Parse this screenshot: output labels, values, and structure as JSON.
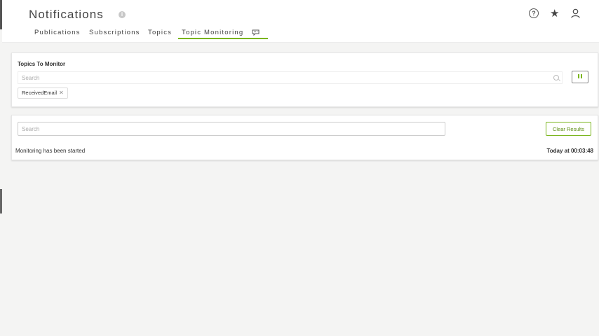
{
  "header": {
    "title": "Notifications",
    "info_icon": "info-icon",
    "icons": [
      "help-icon",
      "star-icon",
      "user-icon"
    ]
  },
  "tabs": [
    {
      "label": "Publications"
    },
    {
      "label": "Subscriptions"
    },
    {
      "label": "Topics"
    },
    {
      "label": "Topic Monitoring",
      "active": true
    }
  ],
  "topics_card": {
    "label": "Topics To Monitor",
    "search_placeholder": "Search",
    "chips": [
      "ReceivedEmail"
    ],
    "pause_icon": "pause-icon"
  },
  "results_card": {
    "search_placeholder": "Search",
    "clear_label": "Clear Results",
    "status_message": "Monitoring has been started",
    "status_time": "Today at 00:03:48"
  },
  "colors": {
    "accent": "#7ab51d",
    "background": "#f4f4f3"
  }
}
